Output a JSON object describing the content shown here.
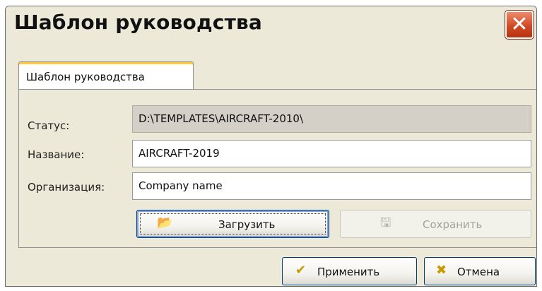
{
  "window": {
    "title": "Шаблон руководства",
    "close_icon": "close-icon"
  },
  "tabs": [
    {
      "label": "Шаблон руководства"
    }
  ],
  "form": {
    "status_label": "Статус:",
    "status_value": "D:\\TEMPLATES\\AIRCRAFT-2010\\",
    "name_label": "Название:",
    "name_value": "AIRCRAFT-2019",
    "org_label": "Организация:",
    "org_value": "Company name"
  },
  "buttons": {
    "load_label": "Загрузить",
    "save_label": "Сохранить",
    "apply_label": "Применить",
    "cancel_label": "Отмена"
  },
  "colors": {
    "window_bg": "#ece9d8",
    "close_red": "#d14a26",
    "tab_accent": "#ffc83c"
  }
}
